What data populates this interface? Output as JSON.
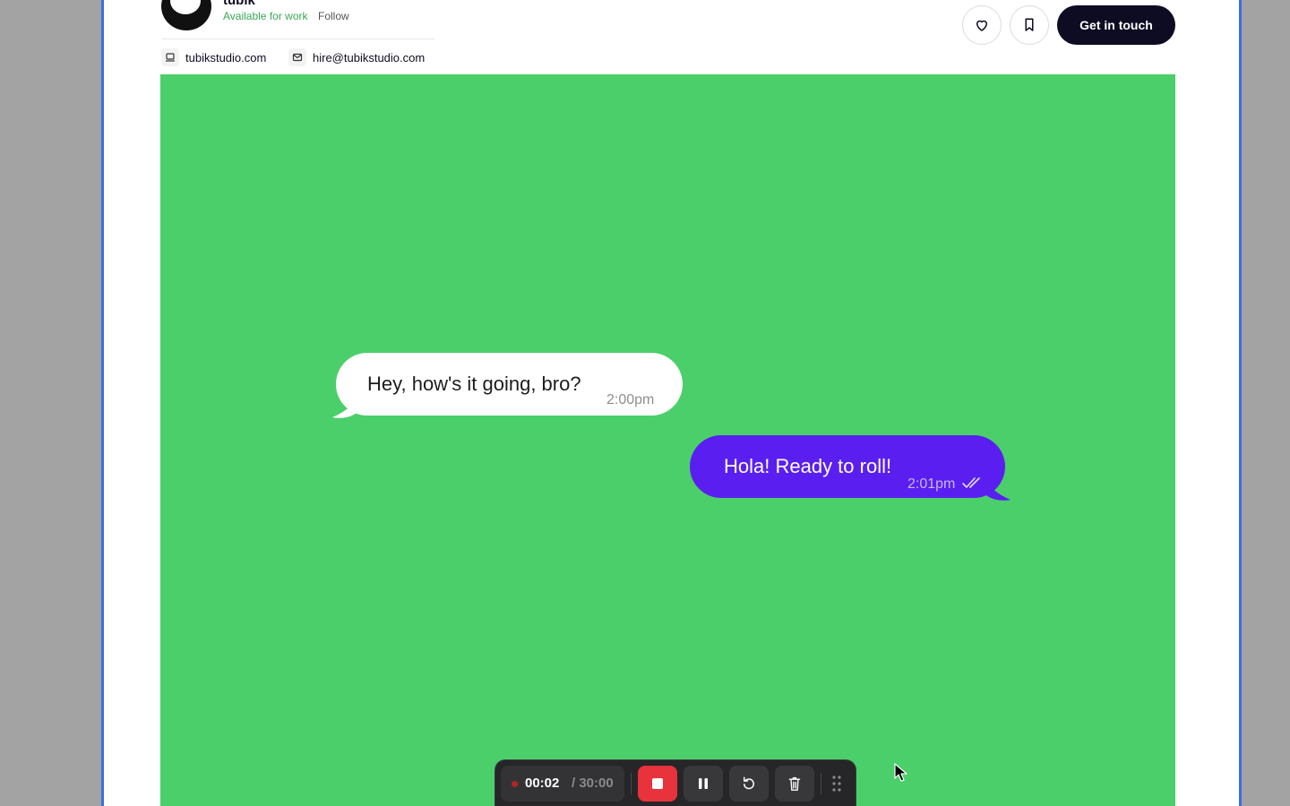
{
  "header": {
    "designer_name": "tubik",
    "availability": "Available for work",
    "follow": "Follow",
    "website": "tubikstudio.com",
    "email": "hire@tubikstudio.com",
    "cta": "Get in touch"
  },
  "chat": {
    "incoming": {
      "text": "Hey, how's it going, bro?",
      "time": "2:00pm"
    },
    "outgoing": {
      "text": "Hola! Ready to roll!",
      "time": "2:01pm"
    }
  },
  "recorder": {
    "elapsed": "00:02",
    "total": "/ 30:00"
  },
  "colors": {
    "shot_background": "#4acf6b",
    "outgoing_bubble": "#5a1ff0",
    "cta_background": "#0d0c22",
    "stop_button": "#e8323c",
    "availability_text": "#3aa757"
  },
  "icons": [
    "laptop-icon",
    "mail-icon",
    "heart-icon",
    "bookmark-icon",
    "stop-icon",
    "pause-icon",
    "restart-icon",
    "trash-icon",
    "drag-handle-icon",
    "mouse-cursor-icon"
  ]
}
